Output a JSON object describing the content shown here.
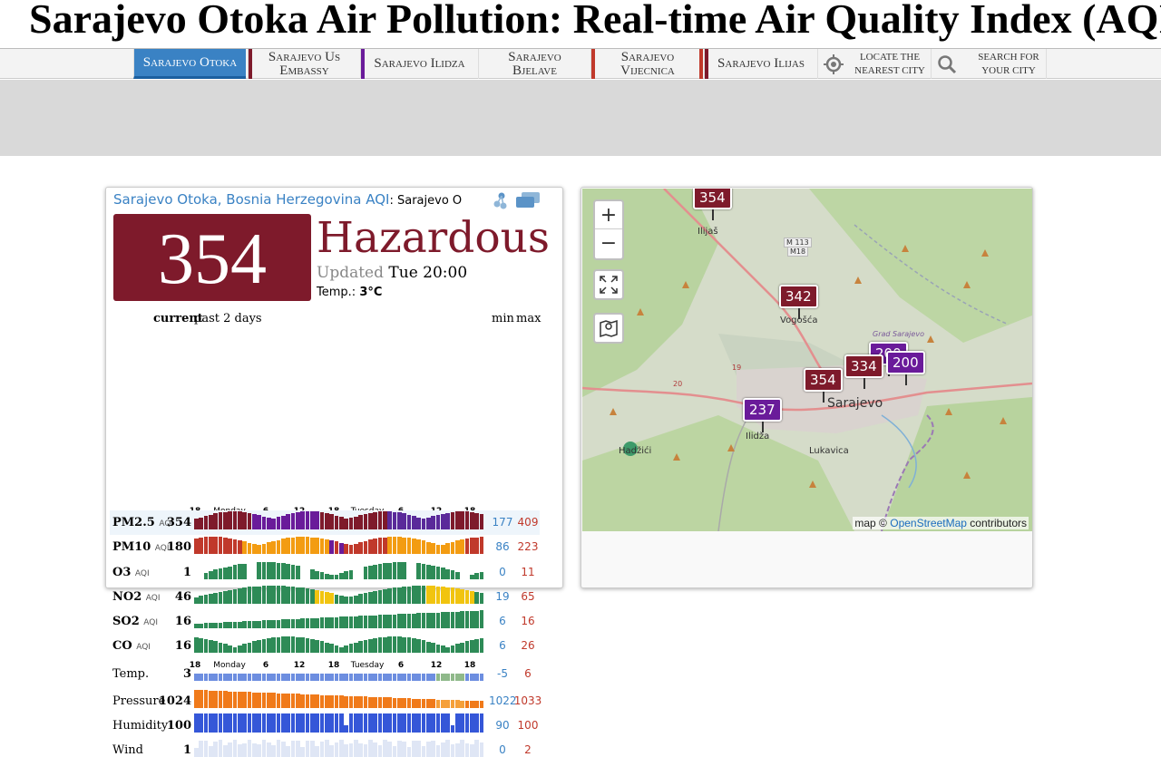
{
  "page": {
    "city_title": "Sarajevo Otoka",
    "title_rest": "Air Pollution: Real-time Air Quality Index (AQI)"
  },
  "nav": {
    "items": [
      {
        "label": "Sarajevo Otoka",
        "stripe": "#7e1a2b",
        "active": true
      },
      {
        "label": "Sarajevo Us Embassy",
        "stripe": "#7e1a2b"
      },
      {
        "label": "Sarajevo Ilidza",
        "stripe": "#6a1b9a"
      },
      {
        "label": "Sarajevo Bjelave",
        "stripe": "#c0392b"
      },
      {
        "label": "Sarajevo Vijecnica",
        "stripe": "#c0392b"
      },
      {
        "label": "Sarajevo Ilijas",
        "stripe": "#7e1a2b"
      }
    ],
    "locate_label": "LOCATE THE NEAREST CITY",
    "search_label": "SEARCH FOR YOUR CITY"
  },
  "station": {
    "name": "Sarajevo Otoka, Bosnia Herzegovina",
    "aqi_link": "AQI",
    "subtitle": ": Sarajevo O",
    "aqi_value": "354",
    "level": "Hazardous",
    "level_color": "#7e1a2b",
    "updated_label": "Updated",
    "updated_value": "Tue 20:00",
    "temp_label": "Temp.:",
    "temp_value": "3°C"
  },
  "history": {
    "header_current": "current",
    "header_past": "past 2 days",
    "header_min": "min",
    "header_max": "max",
    "ticks": [
      "18",
      "Monday",
      "6",
      "12",
      "18",
      "Tuesday",
      "6",
      "12",
      "18"
    ],
    "rows": [
      {
        "name": "PM2.5",
        "aqi": "AQI",
        "current": "354",
        "min": "177",
        "max": "409"
      },
      {
        "name": "PM10",
        "aqi": "AQI",
        "current": "180",
        "min": "86",
        "max": "223"
      },
      {
        "name": "O3",
        "aqi": "AQI",
        "current": "1",
        "min": "0",
        "max": "11"
      },
      {
        "name": "NO2",
        "aqi": "AQI",
        "current": "46",
        "min": "19",
        "max": "65"
      },
      {
        "name": "SO2",
        "aqi": "AQI",
        "current": "16",
        "min": "6",
        "max": "16"
      },
      {
        "name": "CO",
        "aqi": "AQI",
        "current": "16",
        "min": "6",
        "max": "26"
      },
      {
        "name": "Temp.",
        "aqi": "",
        "current": "3",
        "min": "-5",
        "max": "6"
      },
      {
        "name": "Pressure",
        "aqi": "",
        "current": "1024",
        "min": "1022",
        "max": "1033"
      },
      {
        "name": "Humidity",
        "aqi": "",
        "current": "100",
        "min": "90",
        "max": "100"
      },
      {
        "name": "Wind",
        "aqi": "",
        "current": "1",
        "min": "0",
        "max": "2"
      }
    ]
  },
  "map": {
    "zoom_in": "+",
    "zoom_out": "−",
    "attribution_prefix": "map ©",
    "attribution_link": "OpenStreetMap",
    "attribution_suffix": "contributors",
    "places": [
      "Ilijaš",
      "Vogošća",
      "Sarajevo",
      "Ilidža",
      "Lukavica",
      "Hadžići",
      "M 113",
      "M18",
      "Grad Sarajevo",
      "20",
      "19"
    ],
    "markers": [
      {
        "value": "354",
        "color": "#7e1a2b"
      },
      {
        "value": "342",
        "color": "#7e1a2b"
      },
      {
        "value": "200",
        "color": "#6a1b9a"
      },
      {
        "value": "334",
        "color": "#7e1a2b"
      },
      {
        "value": "200",
        "color": "#6a1b9a"
      },
      {
        "value": "354",
        "color": "#7e1a2b"
      },
      {
        "value": "237",
        "color": "#6a1b9a"
      }
    ]
  }
}
